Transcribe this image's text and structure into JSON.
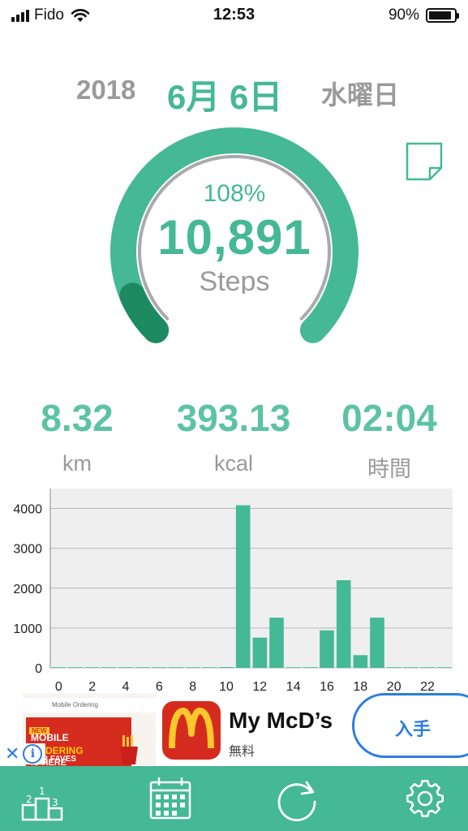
{
  "status_bar": {
    "carrier": "Fido",
    "time": "12:53",
    "battery_percent": "90%",
    "battery_level": 0.9
  },
  "date": {
    "year": "2018",
    "month_day": "6月 6日",
    "weekday": "水曜日"
  },
  "goal": {
    "percent": "108%",
    "steps": "10,891",
    "steps_unit": "Steps",
    "progress_fraction": 1.08
  },
  "stats": {
    "distance": "8.32",
    "distance_unit": "km",
    "calories": "393.13",
    "calories_unit": "kcal",
    "duration": "02:04",
    "duration_unit": "時間"
  },
  "chart_data": {
    "type": "bar",
    "title": "",
    "xlabel": "",
    "ylabel": "",
    "x": [
      0,
      1,
      2,
      3,
      4,
      5,
      6,
      7,
      8,
      9,
      10,
      11,
      12,
      13,
      14,
      15,
      16,
      17,
      18,
      19,
      20,
      21,
      22,
      23
    ],
    "values": [
      0,
      0,
      0,
      0,
      0,
      0,
      0,
      0,
      0,
      0,
      20,
      4080,
      760,
      1260,
      0,
      0,
      940,
      2200,
      320,
      1260,
      0,
      0,
      0,
      0
    ],
    "x_ticks": [
      "0",
      "2",
      "4",
      "6",
      "8",
      "10",
      "12",
      "14",
      "16",
      "18",
      "20",
      "22"
    ],
    "y_ticks": [
      "0",
      "1000",
      "2000",
      "3000",
      "4000"
    ],
    "ylim": [
      0,
      4500
    ],
    "grid": true,
    "bar_color": "#45b896",
    "background": "#efefef"
  },
  "ad": {
    "image_header": "Mobile Ordering",
    "image_badge": "NEW",
    "image_line1": "MOBILE",
    "image_line2": "ORDERING",
    "image_line3": "IS HERE",
    "image_line4": "FOR FAVES",
    "app_name": "My McD’s",
    "price": "無料",
    "cta": "入手"
  },
  "tabs": [
    {
      "name": "ranking",
      "icon": "podium-icon"
    },
    {
      "name": "calendar",
      "icon": "calendar-icon"
    },
    {
      "name": "refresh",
      "icon": "refresh-icon"
    },
    {
      "name": "settings",
      "icon": "gear-icon"
    }
  ],
  "colors": {
    "accent": "#45b896",
    "accent_dark": "#1e8a62",
    "muted": "#9a9a9a",
    "ad_blue": "#2a7de1"
  }
}
